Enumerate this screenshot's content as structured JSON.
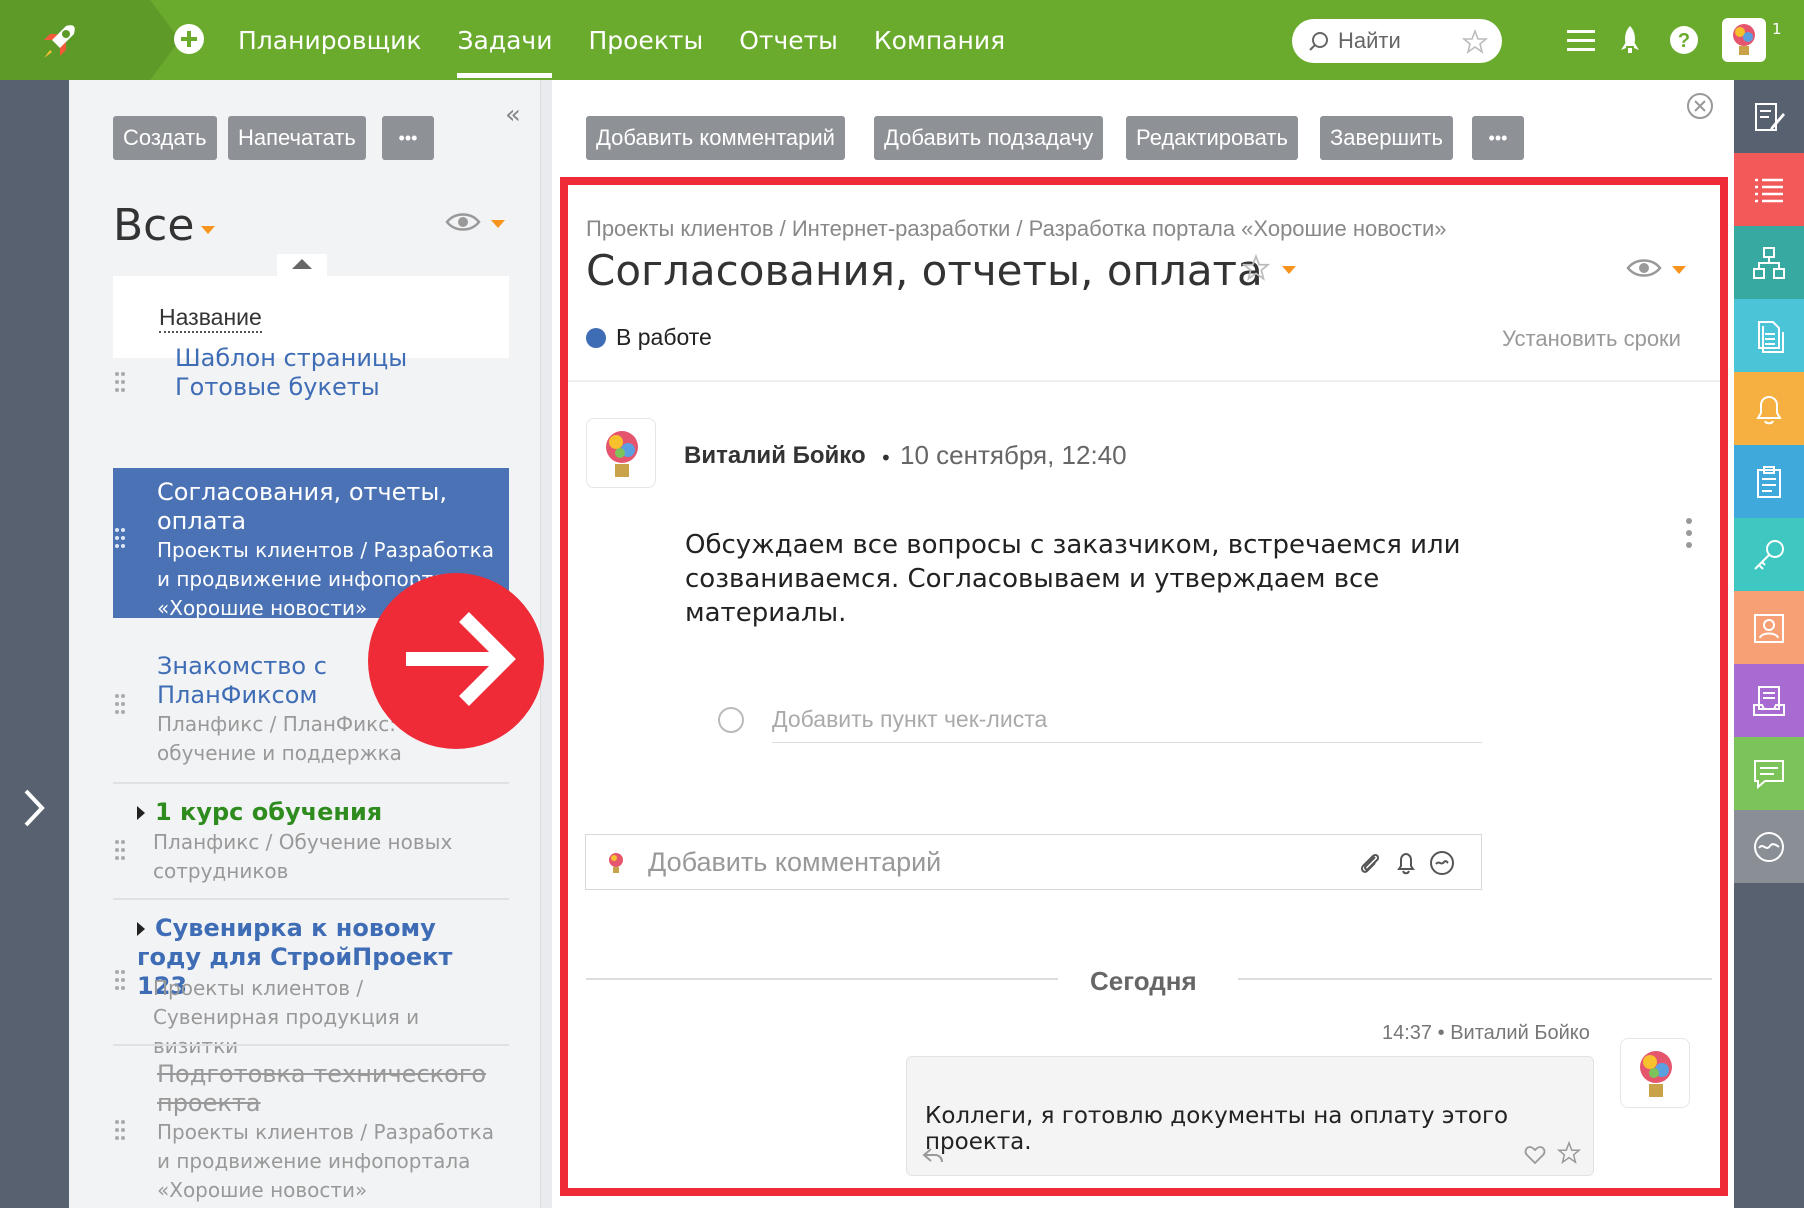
{
  "nav": {
    "items": [
      {
        "label": "Планировщик",
        "active": false
      },
      {
        "label": "Задачи",
        "active": true
      },
      {
        "label": "Проекты",
        "active": false
      },
      {
        "label": "Отчеты",
        "active": false
      },
      {
        "label": "Компания",
        "active": false
      }
    ],
    "search_placeholder": "Найти",
    "badge": "1"
  },
  "list": {
    "buttons": {
      "create": "Создать",
      "print": "Напечатать",
      "more": "•••"
    },
    "collapse": "«",
    "filter_title": "Все",
    "column_header": "Название",
    "tasks": [
      {
        "title": "Шаблон страницы Готовые букеты",
        "subtitle": ""
      },
      {
        "title": "Согласования, отчеты, оплата",
        "subtitle": "Проекты клиентов / Разработка и продвижение инфопортала «Хорошие новости»"
      },
      {
        "title": "Знакомство с ПланФиксом",
        "subtitle": "Планфикс / ПланФикс: обучение и поддержка"
      },
      {
        "title": "1 курс обучения",
        "subtitle": "Планфикс / Обучение новых сотрудников"
      },
      {
        "title": "Сувенирка к новому году для СтройПроект 123",
        "subtitle": "Проекты клиентов / Сувенирная продукция и визитки"
      },
      {
        "title": "Подготовка технического проекта",
        "subtitle": "Проекты клиентов / Разработка и продвижение инфопортала «Хорошие новости»"
      }
    ]
  },
  "detail": {
    "buttons": {
      "add_comment": "Добавить комментарий",
      "add_subtask": "Добавить подзадачу",
      "edit": "Редактировать",
      "complete": "Завершить",
      "more": "•••"
    },
    "breadcrumb": "Проекты клиентов / Интернет-разработки / Разработка портала «Хорошие новости»",
    "title": "Согласования, отчеты, оплата",
    "status": "В работе",
    "set_deadlines": "Установить сроки",
    "post": {
      "author": "Виталий Бойко",
      "date": "10 сентября, 12:40",
      "text": "Обсуждаем все вопросы с заказчиком, встречаемся или созваниваемся. Согласовываем и утверждаем все материалы."
    },
    "checklist_placeholder": "Добавить пункт чек-листа",
    "comment_placeholder": "Добавить комментарий",
    "day_separator": "Сегодня",
    "message": {
      "time": "14:37",
      "author": "Виталий Бойко",
      "text": "Коллеги, я готовлю документы на оплату этого проекта."
    }
  },
  "colors": {
    "topbar": "#6aab2e",
    "accent_selected": "#4a72b5",
    "highlight_frame": "#ee2b36",
    "status_dot": "#3f6db5",
    "sidebar_icons": [
      "#586170",
      "#f25a5a",
      "#37a9a0",
      "#4cc4d8",
      "#f5b041",
      "#3fa9dc",
      "#3ec8c1",
      "#f7a076",
      "#a86bd1",
      "#7cc35a",
      "#8a8f96"
    ]
  },
  "icons": [
    "rocket-icon",
    "plus-icon",
    "search-icon",
    "star-icon",
    "menu-icon",
    "rocket-small-icon",
    "help-icon",
    "avatar",
    "eye-icon",
    "close-icon",
    "attach-icon",
    "bell-icon",
    "smile-icon",
    "reply-icon",
    "heart-icon",
    "chevron-right-icon",
    "arrow-right-icon"
  ]
}
